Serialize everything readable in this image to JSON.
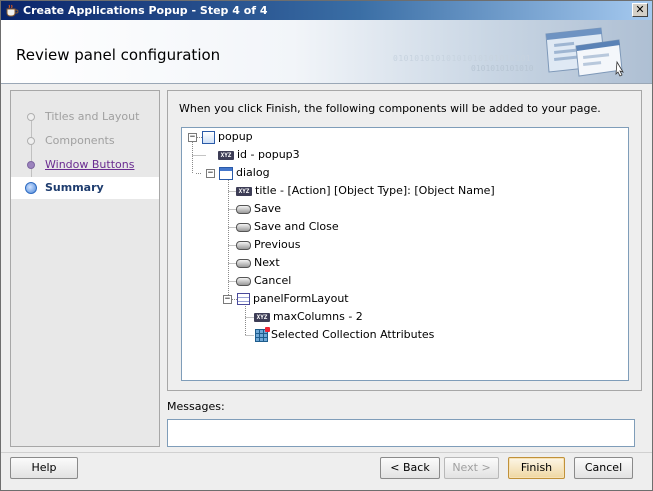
{
  "window": {
    "title": "Create Applications Popup - Step 4 of 4",
    "close_glyph": "✕"
  },
  "header": {
    "title": "Review panel configuration",
    "decor_binary_1": "01010101010101010101010101",
    "decor_binary_2": "0101010101010"
  },
  "nav": {
    "items": [
      {
        "label": "Titles and Layout",
        "state": "completed"
      },
      {
        "label": "Components",
        "state": "completed"
      },
      {
        "label": "Window Buttons",
        "state": "link"
      },
      {
        "label": "Summary",
        "state": "current"
      }
    ]
  },
  "main": {
    "intro": "When you click Finish, the following components will be added to your page.",
    "tree": [
      {
        "label": "popup",
        "icon": "popup-icon",
        "expanded": true
      },
      {
        "label": "id - popup3",
        "icon": "field-icon"
      },
      {
        "label": "dialog",
        "icon": "dialog-icon",
        "expanded": true
      },
      {
        "label": "title - [Action] [Object Type]: [Object Name]",
        "icon": "field-icon"
      },
      {
        "label": "Save",
        "icon": "button-icon"
      },
      {
        "label": "Save and Close",
        "icon": "button-icon"
      },
      {
        "label": "Previous",
        "icon": "button-icon"
      },
      {
        "label": "Next",
        "icon": "button-icon"
      },
      {
        "label": "Cancel",
        "icon": "button-icon"
      },
      {
        "label": "panelFormLayout",
        "icon": "form-layout-icon",
        "expanded": true
      },
      {
        "label": "maxColumns - 2",
        "icon": "field-icon"
      },
      {
        "label": "Selected Collection Attributes",
        "icon": "table-grid-icon"
      }
    ],
    "field_icon_text": "XYZ",
    "expander_minus": "−"
  },
  "messages": {
    "label": "Messages:",
    "value": ""
  },
  "buttons": {
    "help": "Help",
    "back": "< Back",
    "next": "Next >",
    "finish": "Finish",
    "cancel": "Cancel"
  }
}
